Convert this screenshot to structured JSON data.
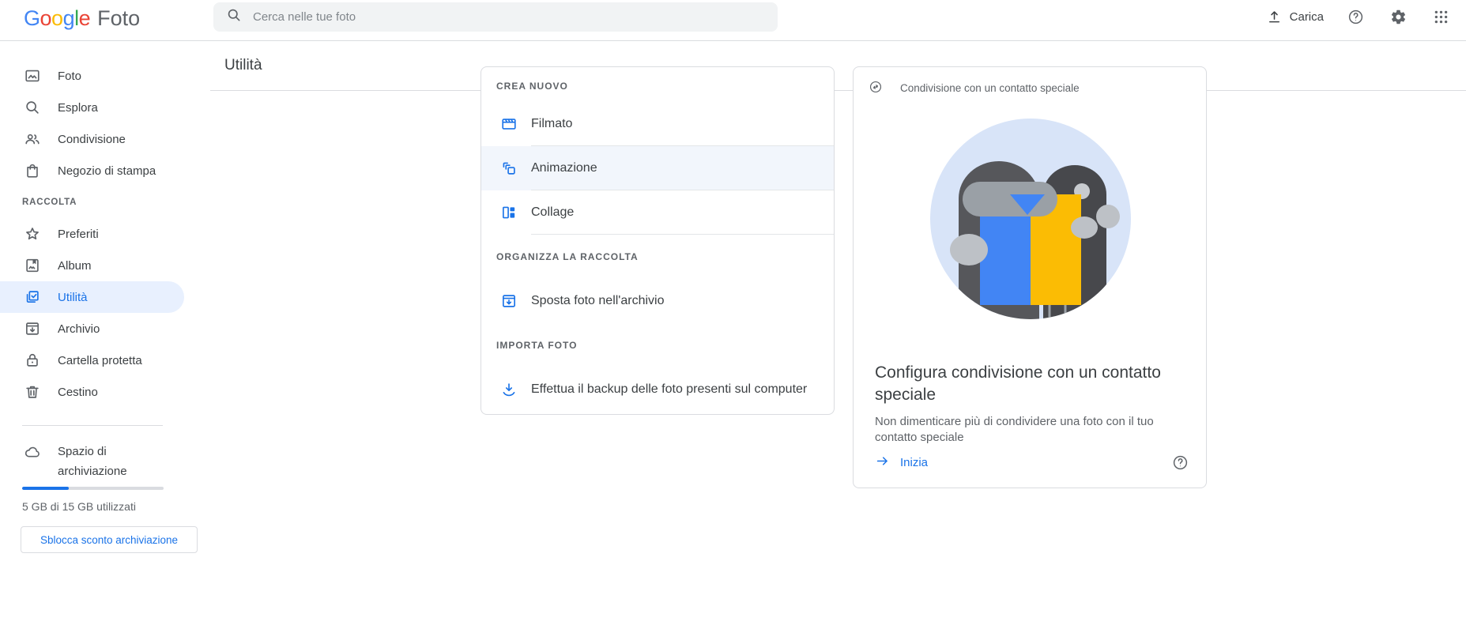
{
  "brand": {
    "letters": [
      "G",
      "o",
      "o",
      "g",
      "l",
      "e"
    ],
    "product": "Foto"
  },
  "topbar": {
    "search_placeholder": "Cerca nelle tue foto",
    "upload_label": "Carica"
  },
  "sidebar": {
    "items": [
      {
        "label": "Foto",
        "icon": "photo-icon"
      },
      {
        "label": "Esplora",
        "icon": "search-icon"
      },
      {
        "label": "Condivisione",
        "icon": "people-icon"
      },
      {
        "label": "Negozio di stampa",
        "icon": "shopping-bag-icon"
      }
    ],
    "section_label": "RACCOLTA",
    "collection_items": [
      {
        "label": "Preferiti",
        "icon": "star-icon",
        "selected": false
      },
      {
        "label": "Album",
        "icon": "album-icon",
        "selected": false
      },
      {
        "label": "Utilità",
        "icon": "utilities-check-icon",
        "selected": true
      },
      {
        "label": "Archivio",
        "icon": "archive-icon",
        "selected": false
      },
      {
        "label": "Cartella protetta",
        "icon": "lock-icon",
        "selected": false
      },
      {
        "label": "Cestino",
        "icon": "trash-icon",
        "selected": false
      }
    ],
    "storage": {
      "label": "Spazio di archiviazione",
      "usage": "5 GB di 15 GB utilizzati",
      "used_fraction": 0.33,
      "button_label": "Sblocca sconto archiviazione"
    }
  },
  "main": {
    "title": "Utilità",
    "utilities": {
      "create_header": "CREA NUOVO",
      "create_items": [
        "Filmato",
        "Animazione",
        "Collage"
      ],
      "organize_header": "ORGANIZZA LA RACCOLTA",
      "organize_items": [
        "Sposta foto nell'archivio"
      ],
      "import_header": "IMPORTA FOTO",
      "import_items": [
        "Effettua il backup delle foto presenti sul computer"
      ]
    },
    "partner": {
      "header": "Condivisione con un contatto speciale",
      "title": "Configura condivisione con un contatto speciale",
      "body": "Non dimenticare più di condividere una foto con il tuo contatto speciale",
      "cta": "Inizia"
    }
  },
  "icons": {
    "search": "magnifier",
    "upload": "arrow-up-from-line",
    "help": "question-circle",
    "settings": "gear",
    "apps": "grid-9-dots",
    "movie": "clapperboard",
    "animation": "stacked-layers",
    "collage": "split-tiles",
    "move-to-archive": "box-down-arrow",
    "backup": "download-arrow",
    "partner-sharing": "circled-swap-arrows",
    "start": "arrow-right"
  },
  "colors": {
    "accent": "#1a73e8",
    "selected_bg": "#e8f0fe",
    "border": "#dadce0",
    "muted_text": "#5f6368",
    "text": "#3c4043",
    "search_bg": "#f1f3f4",
    "highlight_row": "#f2f6fc",
    "illustration_circle": "#d8e4f8",
    "photo_blue": "#4285f4",
    "photo_yellow": "#fbbc04",
    "logo_colors": [
      "#4285F4",
      "#EA4335",
      "#FBBC05",
      "#4285F4",
      "#34A853",
      "#EA4335"
    ]
  }
}
